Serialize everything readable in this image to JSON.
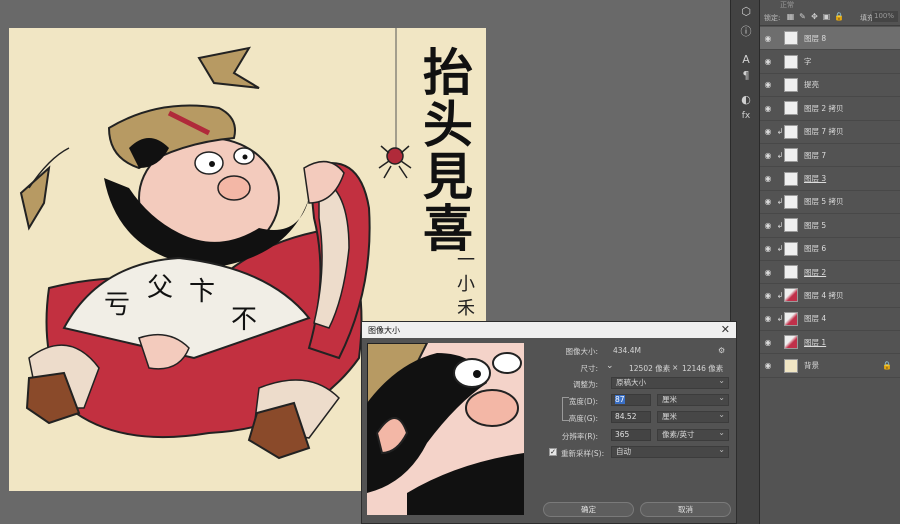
{
  "canvas": {
    "title_chars": [
      "抬",
      "头",
      "見",
      "喜"
    ],
    "signature": "一小禾"
  },
  "toolbar": {
    "icons": [
      "cube-icon",
      "info-icon",
      "character-icon",
      "paragraph-icon",
      "adjustments-icon",
      "styles-icon"
    ],
    "glyphs": [
      "⬡",
      "ⓘ",
      "A",
      "¶",
      "◐",
      "fx"
    ]
  },
  "layers_panel": {
    "blend_mode": "正常",
    "lock_label": "锁定:",
    "fill_label": "填充:",
    "fill_value": "100%",
    "layers": [
      {
        "name": "图层 8",
        "selected": true,
        "clip": false,
        "thumb": "white",
        "underline": false,
        "locked": false
      },
      {
        "name": "字",
        "selected": false,
        "clip": false,
        "thumb": "white",
        "underline": false,
        "locked": false
      },
      {
        "name": "提亮",
        "selected": false,
        "clip": false,
        "thumb": "white",
        "underline": false,
        "locked": false
      },
      {
        "name": "图层 2 拷贝",
        "selected": false,
        "clip": false,
        "thumb": "white",
        "underline": false,
        "locked": false
      },
      {
        "name": "图层 7 拷贝",
        "selected": false,
        "clip": true,
        "thumb": "white",
        "underline": false,
        "locked": false
      },
      {
        "name": "图层 7",
        "selected": false,
        "clip": true,
        "thumb": "white",
        "underline": false,
        "locked": false
      },
      {
        "name": "图层 3",
        "selected": false,
        "clip": false,
        "thumb": "white",
        "underline": true,
        "locked": false
      },
      {
        "name": "图层 5 拷贝",
        "selected": false,
        "clip": true,
        "thumb": "white",
        "underline": false,
        "locked": false
      },
      {
        "name": "图层 5",
        "selected": false,
        "clip": true,
        "thumb": "white",
        "underline": false,
        "locked": false
      },
      {
        "name": "图层 6",
        "selected": false,
        "clip": true,
        "thumb": "white",
        "underline": false,
        "locked": false
      },
      {
        "name": "图层 2",
        "selected": false,
        "clip": false,
        "thumb": "white",
        "underline": true,
        "locked": false
      },
      {
        "name": "图层 4 拷贝",
        "selected": false,
        "clip": true,
        "thumb": "red",
        "underline": false,
        "locked": false
      },
      {
        "name": "图层 4",
        "selected": false,
        "clip": true,
        "thumb": "red",
        "underline": false,
        "locked": false
      },
      {
        "name": "图层 1",
        "selected": false,
        "clip": false,
        "thumb": "red",
        "underline": true,
        "locked": false
      },
      {
        "name": "背景",
        "selected": false,
        "clip": false,
        "thumb": "tan",
        "underline": false,
        "locked": true
      }
    ]
  },
  "dialog": {
    "title": "图像大小",
    "close_glyph": "✕",
    "image_size_label": "图像大小:",
    "image_size_value": "434.4M",
    "dimensions_label": "尺寸:",
    "dimensions_w": "12502 像素",
    "dimensions_x": "×",
    "dimensions_h": "12146 像素",
    "fit_label": "调整为:",
    "fit_value": "原稿大小",
    "width_label": "宽度(D):",
    "width_value": "87",
    "width_unit": "厘米",
    "height_label": "高度(G):",
    "height_value": "84.52",
    "height_unit": "厘米",
    "resolution_label": "分辨率(R):",
    "resolution_value": "365",
    "resolution_unit": "像素/英寸",
    "resample_label": "重新采样(S):",
    "resample_checked": "✓",
    "resample_value": "自动",
    "ok_label": "确定",
    "cancel_label": "取消"
  }
}
